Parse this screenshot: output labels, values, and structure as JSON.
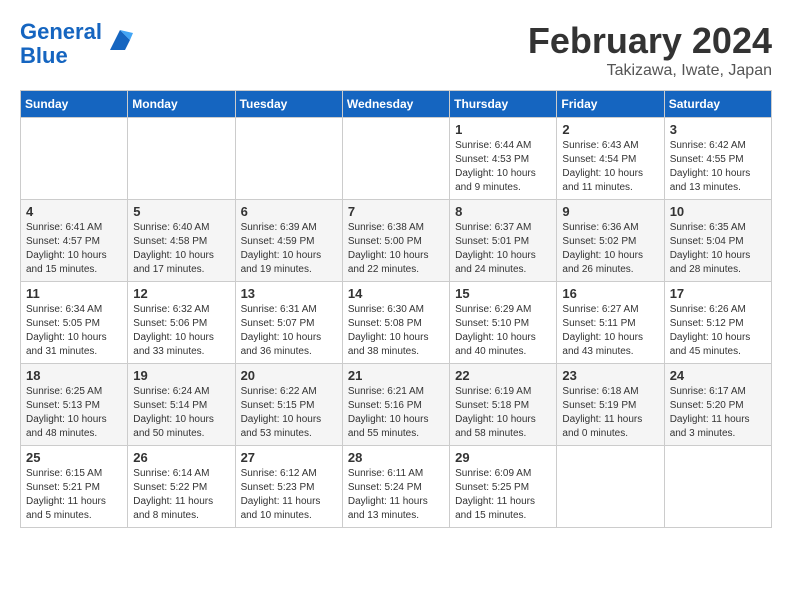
{
  "header": {
    "logo_line1": "General",
    "logo_line2": "Blue",
    "title": "February 2024",
    "subtitle": "Takizawa, Iwate, Japan"
  },
  "weekdays": [
    "Sunday",
    "Monday",
    "Tuesday",
    "Wednesday",
    "Thursday",
    "Friday",
    "Saturday"
  ],
  "weeks": [
    [
      {
        "day": "",
        "info": ""
      },
      {
        "day": "",
        "info": ""
      },
      {
        "day": "",
        "info": ""
      },
      {
        "day": "",
        "info": ""
      },
      {
        "day": "1",
        "info": "Sunrise: 6:44 AM\nSunset: 4:53 PM\nDaylight: 10 hours\nand 9 minutes."
      },
      {
        "day": "2",
        "info": "Sunrise: 6:43 AM\nSunset: 4:54 PM\nDaylight: 10 hours\nand 11 minutes."
      },
      {
        "day": "3",
        "info": "Sunrise: 6:42 AM\nSunset: 4:55 PM\nDaylight: 10 hours\nand 13 minutes."
      }
    ],
    [
      {
        "day": "4",
        "info": "Sunrise: 6:41 AM\nSunset: 4:57 PM\nDaylight: 10 hours\nand 15 minutes."
      },
      {
        "day": "5",
        "info": "Sunrise: 6:40 AM\nSunset: 4:58 PM\nDaylight: 10 hours\nand 17 minutes."
      },
      {
        "day": "6",
        "info": "Sunrise: 6:39 AM\nSunset: 4:59 PM\nDaylight: 10 hours\nand 19 minutes."
      },
      {
        "day": "7",
        "info": "Sunrise: 6:38 AM\nSunset: 5:00 PM\nDaylight: 10 hours\nand 22 minutes."
      },
      {
        "day": "8",
        "info": "Sunrise: 6:37 AM\nSunset: 5:01 PM\nDaylight: 10 hours\nand 24 minutes."
      },
      {
        "day": "9",
        "info": "Sunrise: 6:36 AM\nSunset: 5:02 PM\nDaylight: 10 hours\nand 26 minutes."
      },
      {
        "day": "10",
        "info": "Sunrise: 6:35 AM\nSunset: 5:04 PM\nDaylight: 10 hours\nand 28 minutes."
      }
    ],
    [
      {
        "day": "11",
        "info": "Sunrise: 6:34 AM\nSunset: 5:05 PM\nDaylight: 10 hours\nand 31 minutes."
      },
      {
        "day": "12",
        "info": "Sunrise: 6:32 AM\nSunset: 5:06 PM\nDaylight: 10 hours\nand 33 minutes."
      },
      {
        "day": "13",
        "info": "Sunrise: 6:31 AM\nSunset: 5:07 PM\nDaylight: 10 hours\nand 36 minutes."
      },
      {
        "day": "14",
        "info": "Sunrise: 6:30 AM\nSunset: 5:08 PM\nDaylight: 10 hours\nand 38 minutes."
      },
      {
        "day": "15",
        "info": "Sunrise: 6:29 AM\nSunset: 5:10 PM\nDaylight: 10 hours\nand 40 minutes."
      },
      {
        "day": "16",
        "info": "Sunrise: 6:27 AM\nSunset: 5:11 PM\nDaylight: 10 hours\nand 43 minutes."
      },
      {
        "day": "17",
        "info": "Sunrise: 6:26 AM\nSunset: 5:12 PM\nDaylight: 10 hours\nand 45 minutes."
      }
    ],
    [
      {
        "day": "18",
        "info": "Sunrise: 6:25 AM\nSunset: 5:13 PM\nDaylight: 10 hours\nand 48 minutes."
      },
      {
        "day": "19",
        "info": "Sunrise: 6:24 AM\nSunset: 5:14 PM\nDaylight: 10 hours\nand 50 minutes."
      },
      {
        "day": "20",
        "info": "Sunrise: 6:22 AM\nSunset: 5:15 PM\nDaylight: 10 hours\nand 53 minutes."
      },
      {
        "day": "21",
        "info": "Sunrise: 6:21 AM\nSunset: 5:16 PM\nDaylight: 10 hours\nand 55 minutes."
      },
      {
        "day": "22",
        "info": "Sunrise: 6:19 AM\nSunset: 5:18 PM\nDaylight: 10 hours\nand 58 minutes."
      },
      {
        "day": "23",
        "info": "Sunrise: 6:18 AM\nSunset: 5:19 PM\nDaylight: 11 hours\nand 0 minutes."
      },
      {
        "day": "24",
        "info": "Sunrise: 6:17 AM\nSunset: 5:20 PM\nDaylight: 11 hours\nand 3 minutes."
      }
    ],
    [
      {
        "day": "25",
        "info": "Sunrise: 6:15 AM\nSunset: 5:21 PM\nDaylight: 11 hours\nand 5 minutes."
      },
      {
        "day": "26",
        "info": "Sunrise: 6:14 AM\nSunset: 5:22 PM\nDaylight: 11 hours\nand 8 minutes."
      },
      {
        "day": "27",
        "info": "Sunrise: 6:12 AM\nSunset: 5:23 PM\nDaylight: 11 hours\nand 10 minutes."
      },
      {
        "day": "28",
        "info": "Sunrise: 6:11 AM\nSunset: 5:24 PM\nDaylight: 11 hours\nand 13 minutes."
      },
      {
        "day": "29",
        "info": "Sunrise: 6:09 AM\nSunset: 5:25 PM\nDaylight: 11 hours\nand 15 minutes."
      },
      {
        "day": "",
        "info": ""
      },
      {
        "day": "",
        "info": ""
      }
    ]
  ]
}
